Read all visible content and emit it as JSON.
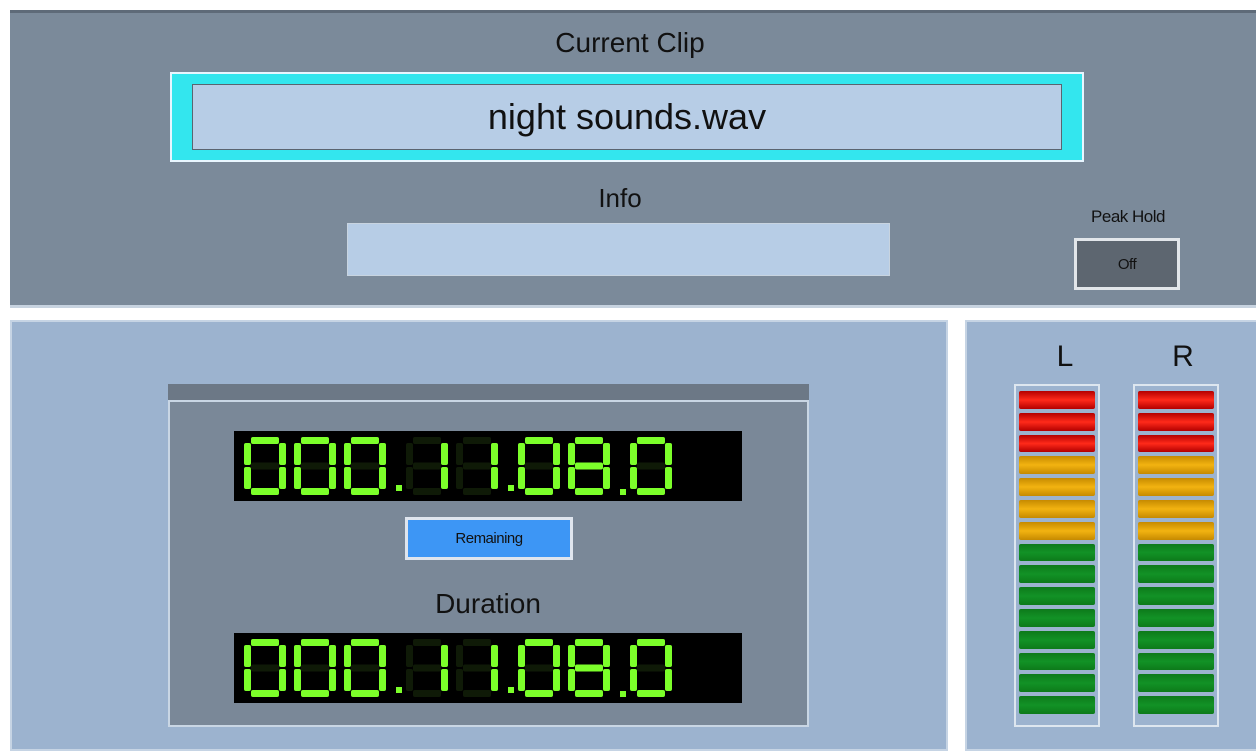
{
  "current_clip": {
    "label": "Current Clip",
    "value": "night sounds.wav"
  },
  "info": {
    "label": "Info",
    "value": ""
  },
  "peak_hold": {
    "label": "Peak Hold",
    "button": "Off"
  },
  "timer": {
    "time_display": "000:11:08.0",
    "mode_button": "Remaining",
    "duration_label": "Duration",
    "duration_display": "000:11:08.0"
  },
  "meters": {
    "left_label": "L",
    "right_label": "R",
    "segments": [
      "red",
      "red",
      "red",
      "amber",
      "amber",
      "amber",
      "amber",
      "green",
      "green",
      "green",
      "green",
      "green",
      "green",
      "green",
      "green"
    ]
  },
  "colors": {
    "lcd_on": "#7cff2a",
    "lcd_off": "#0f1a07",
    "clip_frame": "#33e6ee",
    "remaining_button": "#3d96f5"
  }
}
